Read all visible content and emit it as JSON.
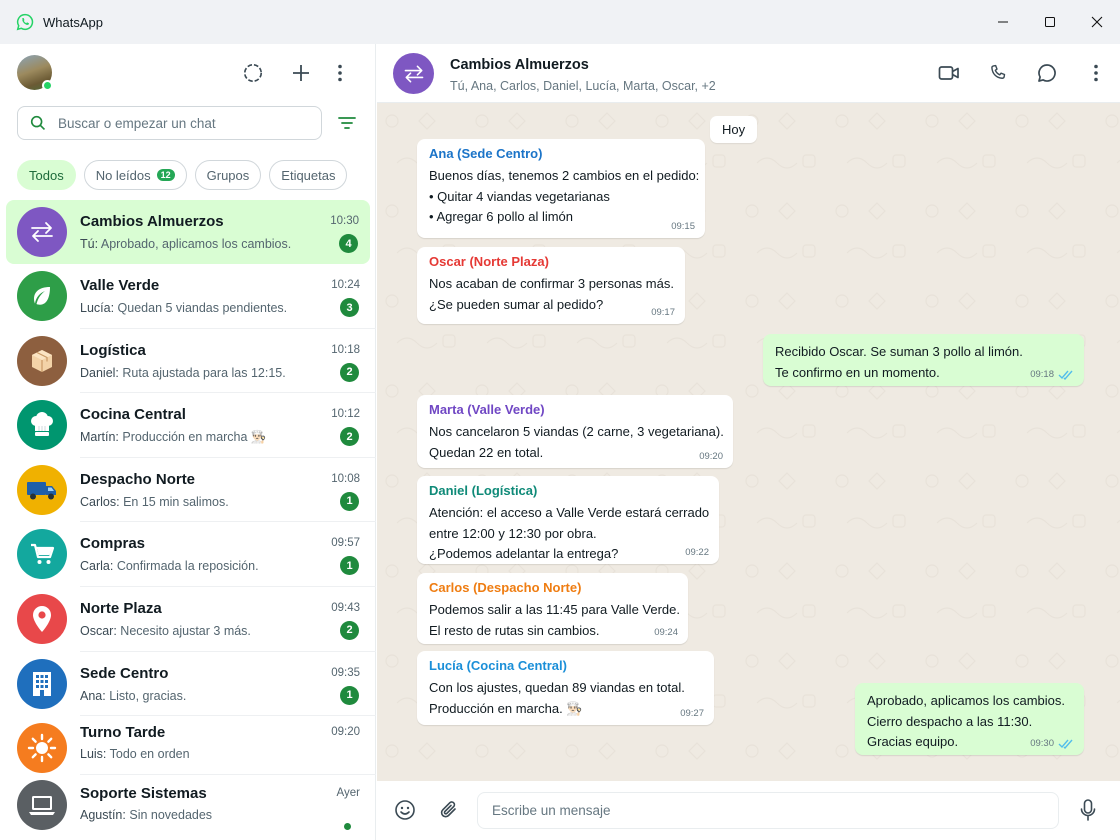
{
  "window": {
    "title": "WhatsApp"
  },
  "sidebar": {
    "search_placeholder": "Buscar o empezar un chat",
    "chips": [
      {
        "label": "Todos"
      },
      {
        "label": "No leídos",
        "count": "12"
      },
      {
        "label": "Grupos"
      },
      {
        "label": "Etiquetas"
      }
    ],
    "chats": [
      {
        "name": "Cambios Almuerzos",
        "sender": "Tú:",
        "preview": "Aprobado, aplicamos los cambios.",
        "time": "10:30",
        "unread": "4",
        "avatar_color": "#7e57c2",
        "icon": "swap-arrows-icon"
      },
      {
        "name": "Valle Verde",
        "sender": "Lucía:",
        "preview": "Quedan 5 viandas pendientes.",
        "time": "10:24",
        "unread": "3",
        "avatar_color": "#2e9e48",
        "icon": "leaf-icon"
      },
      {
        "name": "Logística",
        "sender": "Daniel:",
        "preview": "Ruta ajustada para las 12:15.",
        "time": "10:18",
        "unread": "2",
        "avatar_color": "#8d5f3f",
        "icon": "box-icon"
      },
      {
        "name": "Cocina Central",
        "sender": "Martín:",
        "preview": "Producción en marcha 👨🏻‍🍳",
        "time": "10:12",
        "unread": "2",
        "avatar_color": "#00966f",
        "icon": "chef-hat-icon"
      },
      {
        "name": "Despacho Norte",
        "sender": "Carlos:",
        "preview": "En 15 min salimos.",
        "time": "10:08",
        "unread": "1",
        "avatar_color": "#f0b100",
        "icon": "truck-icon"
      },
      {
        "name": "Compras",
        "sender": "Carla:",
        "preview": "Confirmada la reposición.",
        "time": "09:57",
        "unread": "1",
        "avatar_color": "#13a89e",
        "icon": "cart-icon"
      },
      {
        "name": "Norte Plaza",
        "sender": "Oscar:",
        "preview": "Necesito ajustar 3 más.",
        "time": "09:43",
        "unread": "2",
        "avatar_color": "#e8484a",
        "icon": "location-pin-icon"
      },
      {
        "name": "Sede Centro",
        "sender": "Ana:",
        "preview": "Listo, gracias.",
        "time": "09:35",
        "unread": "1",
        "avatar_color": "#1f6fbd",
        "icon": "building-icon"
      },
      {
        "name": "Turno Tarde",
        "sender": "Luis:",
        "preview": "Todo en orden",
        "time": "09:20",
        "unread": "",
        "avatar_color": "#f57c1f",
        "icon": "sun-icon"
      },
      {
        "name": "Soporte Sistemas",
        "sender": "Agustín:",
        "preview": "Sin novedades",
        "time": "Ayer",
        "unread": "",
        "avatar_color": "#5a5f63",
        "icon": "laptop-icon"
      }
    ]
  },
  "conversation": {
    "title": "Cambios Almuerzos",
    "members": "Tú, Ana, Carlos, Daniel, Lucía, Marta, Oscar, +2",
    "day_label": "Hoy",
    "messages": [
      {
        "dir": "in",
        "sender": "Ana (Sede Centro)",
        "sender_color": "#1b74c8",
        "lines": [
          "Buenos días, tenemos 2 cambios en el pedido:",
          "• Quitar 4 viandas vegetarianas",
          "• Agregar 6 pollo al limón"
        ],
        "time": "09:15"
      },
      {
        "dir": "in",
        "sender": "Oscar (Norte Plaza)",
        "sender_color": "#e53935",
        "lines": [
          "Nos acaban de confirmar 3 personas más.",
          "¿Se pueden sumar al pedido?"
        ],
        "time": "09:17"
      },
      {
        "dir": "out",
        "sender": "",
        "lines": [
          "Recibido Oscar. Se suman 3 pollo al limón.",
          "Te confirmo en un momento."
        ],
        "time": "09:18"
      },
      {
        "dir": "in",
        "sender": "Marta (Valle Verde)",
        "sender_color": "#7047c4",
        "lines": [
          "Nos cancelaron 5 viandas (2 carne, 3 vegetariana).",
          "Quedan 22 en total."
        ],
        "time": "09:20"
      },
      {
        "dir": "in",
        "sender": "Daniel (Logística)",
        "sender_color": "#0f8a78",
        "lines": [
          "Atención: el acceso a Valle Verde estará cerrado",
          "entre 12:00 y 12:30 por obra.",
          "¿Podemos adelantar la entrega?"
        ],
        "time": "09:22"
      },
      {
        "dir": "in",
        "sender": "Carlos (Despacho Norte)",
        "sender_color": "#ef7d12",
        "lines": [
          "Podemos salir a las 11:45 para Valle Verde.",
          "El resto de rutas sin cambios."
        ],
        "time": "09:24"
      },
      {
        "dir": "in",
        "sender": "Lucía (Cocina Central)",
        "sender_color": "#1b8fd8",
        "lines": [
          "Con los ajustes, quedan 89 viandas en total.",
          "Producción en marcha. 👨🏻‍🍳"
        ],
        "time": "09:27"
      },
      {
        "dir": "out",
        "sender": "",
        "lines": [
          "Aprobado, aplicamos los cambios.",
          "Cierro despacho a las 11:30.",
          "Gracias equipo."
        ],
        "time": "09:30"
      }
    ]
  },
  "compose": {
    "placeholder": "Escribe un mensaje"
  },
  "colors": {
    "accent": "#25d366",
    "badge": "#1f8a3d",
    "active_bg": "#d9fdd3",
    "chat_bg": "#efeae2"
  }
}
